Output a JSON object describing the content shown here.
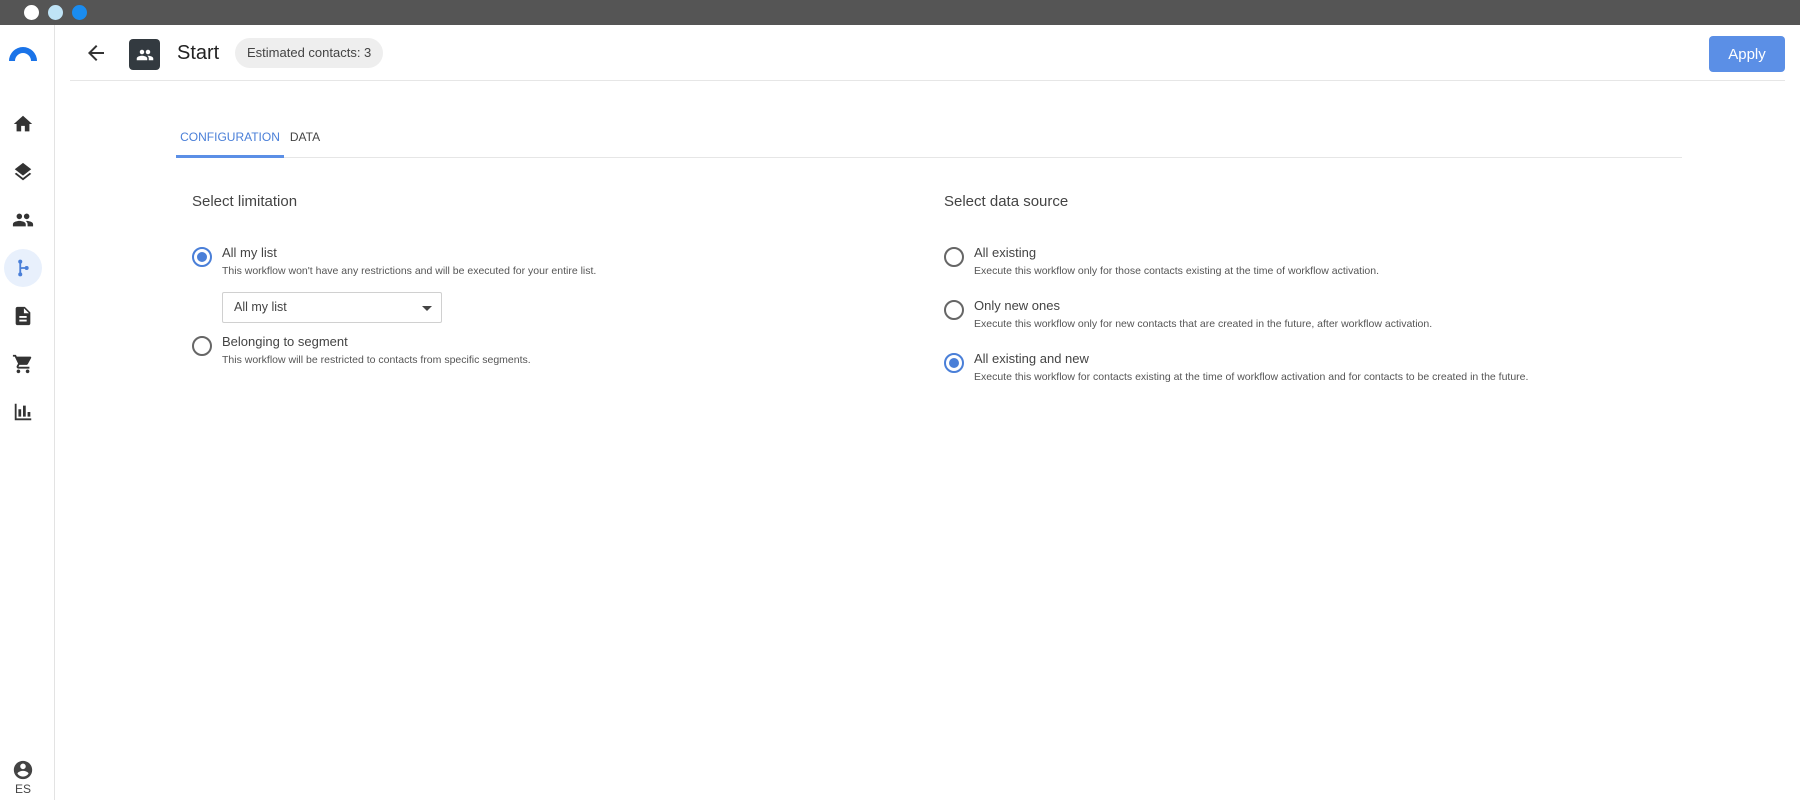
{
  "window": {
    "dot_colors": [
      "#ffffff",
      "#bfe3f6",
      "#1a8cf0"
    ]
  },
  "colors": {
    "accent": "#5b8fe6",
    "active_tab": "#4a7fd8",
    "title_bar": "#555555"
  },
  "sidebar": {
    "logo_icon": "app-logo-icon",
    "items": [
      {
        "icon": "home-icon",
        "active": false
      },
      {
        "icon": "layers-icon",
        "active": false
      },
      {
        "icon": "people-icon",
        "active": false
      },
      {
        "icon": "workflow-icon",
        "active": true
      },
      {
        "icon": "document-icon",
        "active": false
      },
      {
        "icon": "cart-icon",
        "active": false
      },
      {
        "icon": "bar-chart-icon",
        "active": false
      }
    ],
    "user": {
      "icon": "account-circle-icon",
      "language": "ES"
    }
  },
  "header": {
    "back_icon": "arrow-back-icon",
    "node_icon": "people-icon",
    "title": "Start",
    "badge": "Estimated contacts: 3",
    "apply_label": "Apply"
  },
  "tabs": [
    {
      "label": "CONFIGURATION",
      "active": true
    },
    {
      "label": "DATA",
      "active": false
    }
  ],
  "limitation": {
    "title": "Select limitation",
    "options": [
      {
        "label": "All my list",
        "description": "This workflow won't have any restrictions and will be executed for your entire list.",
        "checked": true
      },
      {
        "label": "Belonging to segment",
        "description": "This workflow will be restricted to contacts from specific segments.",
        "checked": false
      }
    ],
    "select_value": "All my list"
  },
  "data_source": {
    "title": "Select data source",
    "options": [
      {
        "label": "All existing",
        "description": "Execute this workflow only for those contacts existing at the time of workflow activation.",
        "checked": false
      },
      {
        "label": "Only new ones",
        "description": "Execute this workflow only for new contacts that are created in the future, after workflow activation.",
        "checked": false
      },
      {
        "label": "All existing and new",
        "description": "Execute this workflow for contacts existing at the time of workflow activation and for contacts to be created in the future.",
        "checked": true
      }
    ]
  }
}
